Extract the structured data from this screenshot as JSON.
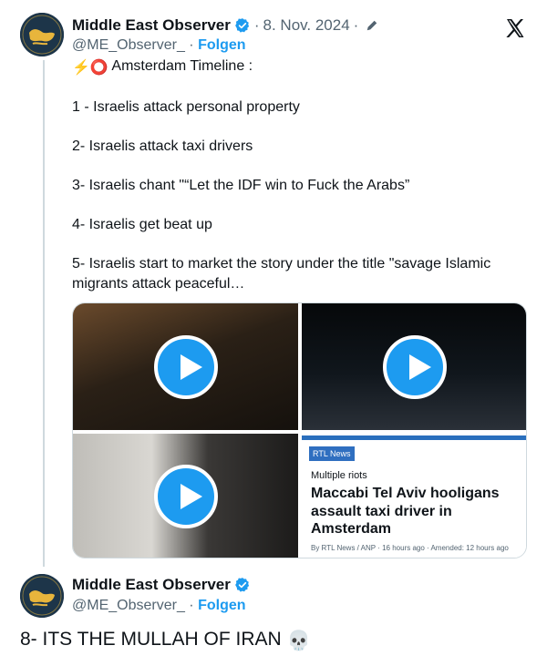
{
  "tweet": {
    "author_name": "Middle East Observer",
    "author_handle": "@ME_Observer_",
    "follow_label": "Folgen",
    "separator": "·",
    "date": "8. Nov. 2024",
    "icons": {
      "verified": "verified-badge-icon",
      "edit": "pencil-icon",
      "platform": "x-logo-icon",
      "avatar": "middle-east-observer-logo"
    },
    "lines": [
      "Amsterdam Timeline :",
      "1 - Israelis attack personal property",
      "2- Israelis attack taxi drivers",
      "3- Israelis chant \"“Let the IDF win to Fuck the Arabs”",
      "4- Israelis get beat up",
      "5- Israelis start to market the story under the title \"savage Islamic migrants attack peaceful…"
    ],
    "title_emojis": "⚡⭕",
    "media": {
      "play_icon": "play-icon",
      "news_card": {
        "badge": "RTL News",
        "kicker": "Multiple riots",
        "headline": "Maccabi Tel Aviv hooligans assault taxi driver in Amsterdam",
        "byline": "By RTL News / ANP · 16 hours ago · Amended: 12 hours ago"
      }
    }
  },
  "reply": {
    "author_name": "Middle East Observer",
    "author_handle": "@ME_Observer_",
    "follow_label": "Folgen",
    "separator": "·",
    "text": "8- ITS THE MULLAH OF IRAN",
    "emoji": "💀"
  },
  "colors": {
    "link_blue": "#1d9bf0",
    "secondary_text": "#536471",
    "border": "#cfd9de",
    "news_blue": "#2f6fc0"
  }
}
